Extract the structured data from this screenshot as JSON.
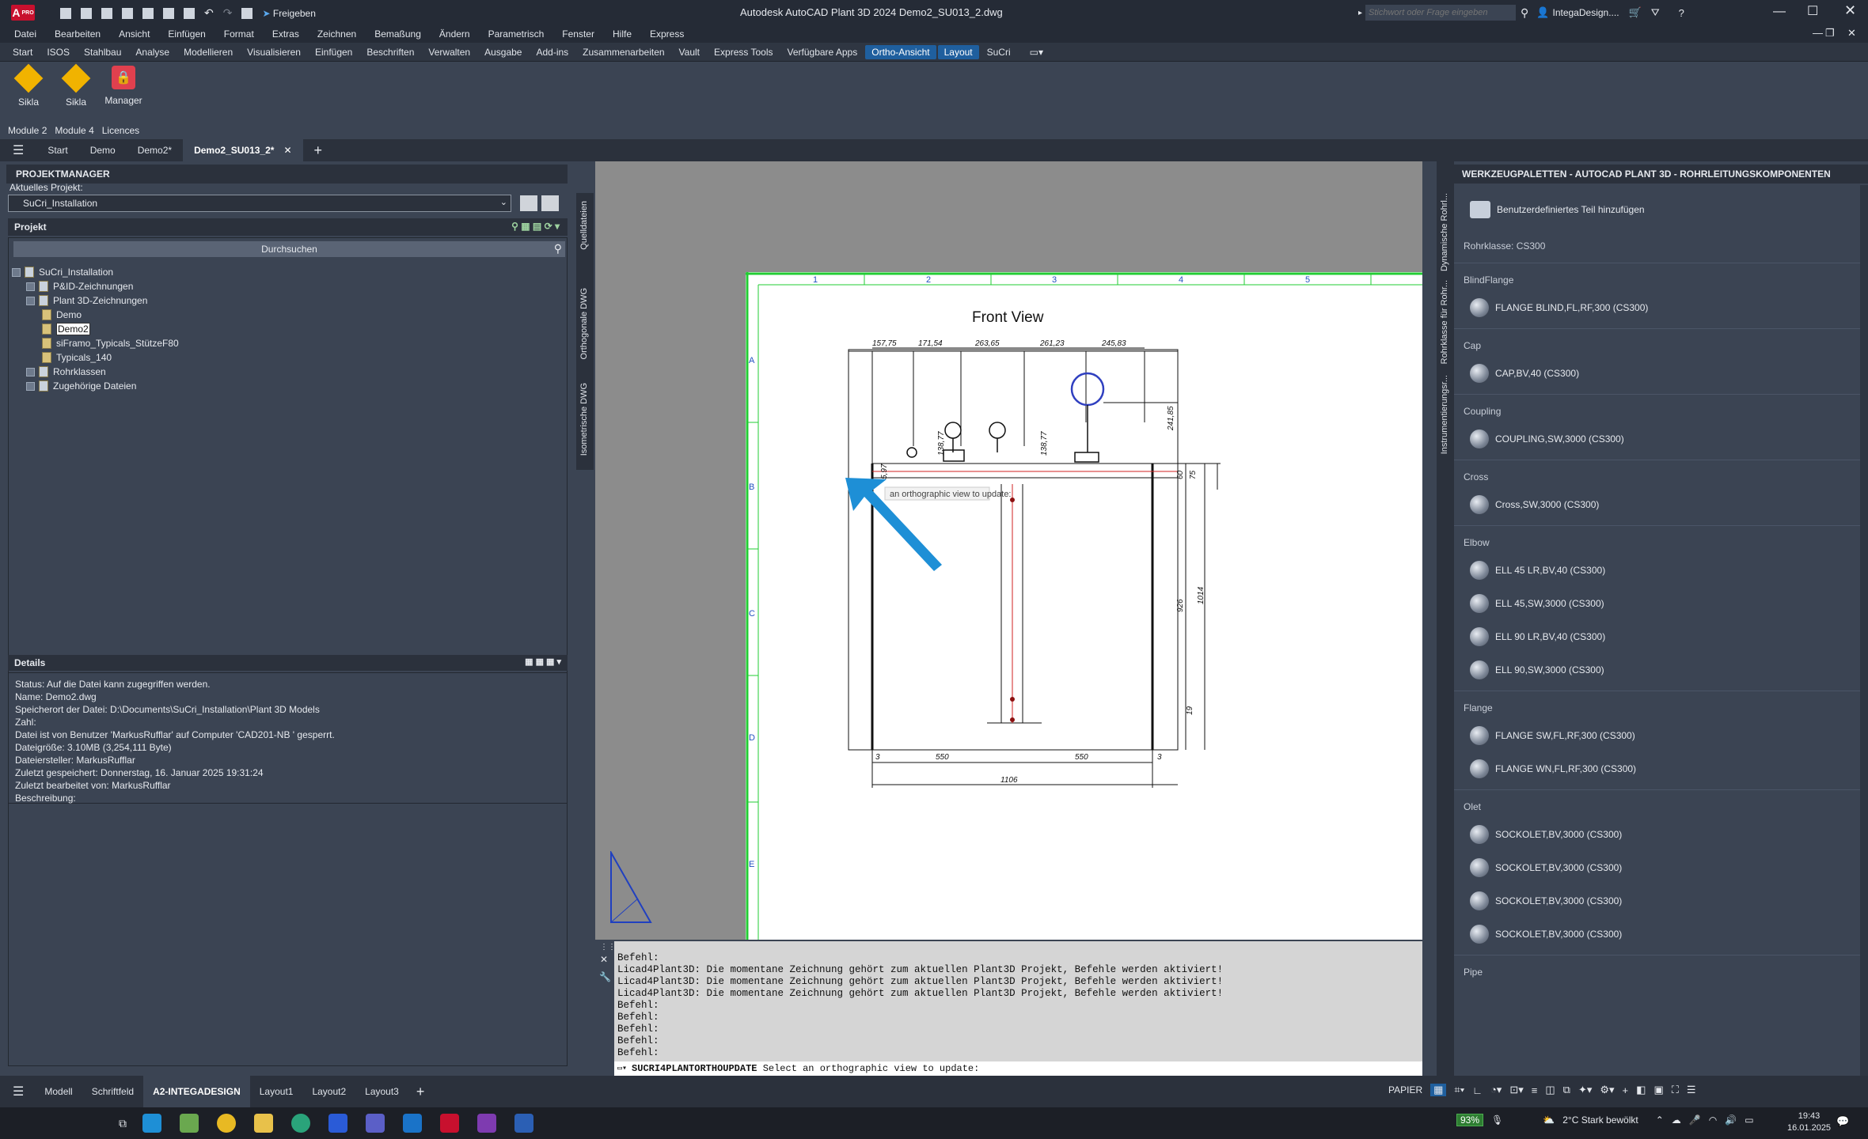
{
  "titlebar": {
    "app_badge": "A",
    "app_sub": "PRO",
    "share": "Freigeben",
    "title": "Autodesk AutoCAD Plant 3D 2024   Demo2_SU013_2.dwg",
    "search_placeholder": "Stichwort oder Frage eingeben",
    "user": "IntegaDesign...."
  },
  "menu": [
    "Datei",
    "Bearbeiten",
    "Ansicht",
    "Einfügen",
    "Format",
    "Extras",
    "Zeichnen",
    "Bemaßung",
    "Ändern",
    "Parametrisch",
    "Fenster",
    "Hilfe",
    "Express"
  ],
  "ribbon_tabs": [
    "Start",
    "ISOS",
    "Stahlbau",
    "Analyse",
    "Modellieren",
    "Visualisieren",
    "Einfügen",
    "Beschriften",
    "Verwalten",
    "Ausgabe",
    "Add-ins",
    "Zusammenarbeiten",
    "Vault",
    "Express Tools",
    "Verfügbare Apps",
    "Ortho-Ansicht",
    "Layout",
    "SuCri"
  ],
  "ribbon_buttons": [
    "Sikla",
    "Sikla",
    "Manager"
  ],
  "modules": [
    "Module 2",
    "Module 4",
    "Licences"
  ],
  "doc_tabs": [
    "Start",
    "Demo",
    "Demo2*",
    "Demo2_SU013_2*"
  ],
  "pm": {
    "title": "PROJEKTMANAGER",
    "current_label": "Aktuelles Projekt:",
    "current_value": "SuCri_Installation",
    "project_label": "Projekt",
    "search_btn": "Durchsuchen",
    "tree": [
      "SuCri_Installation",
      "P&ID-Zeichnungen",
      "Plant 3D-Zeichnungen",
      "Demo",
      "Demo2",
      "siFramo_Typicals_StützeF80",
      "Typicals_140",
      "Rohrklassen",
      "Zugehörige Dateien"
    ],
    "details_label": "Details",
    "details": [
      "Status: Auf die Datei kann zugegriffen werden.",
      "Name:  Demo2.dwg",
      "Speicherort der Datei:  D:\\Documents\\SuCri_Installation\\Plant 3D Models",
      "Zahl:",
      "Datei ist von Benutzer 'MarkusRufflar' auf Computer 'CAD201-NB ' gesperrt.",
      "Dateigröße: 3.10MB (3,254,111 Byte)",
      "Dateiersteller:  MarkusRufflar",
      "Zuletzt gespeichert: Donnerstag, 16. Januar 2025 19:31:24",
      "Zuletzt bearbeitet von:  MarkusRufflar",
      "Beschreibung:"
    ]
  },
  "vtabs_left": [
    "Quelldateien",
    "Orthogonale DWG",
    "Isometrische DWG"
  ],
  "drawing": {
    "view_title": "Front View",
    "col_labels": [
      "1",
      "2",
      "3",
      "4",
      "5"
    ],
    "row_labels": [
      "A",
      "B",
      "C",
      "D",
      "E"
    ],
    "dims_top": [
      "157,75",
      "171,54",
      "263,65",
      "261,23",
      "245,83"
    ],
    "dims_bottom": [
      "3",
      "550",
      "550",
      "3",
      "1106"
    ],
    "dims_right": [
      "241,85",
      "60",
      "75",
      "926",
      "1014",
      "19"
    ],
    "dims_mid": [
      "138,77",
      "138,77",
      "5,97"
    ],
    "tooltip": "an orthographic view to update:"
  },
  "cmd": {
    "lines": [
      "Befehl:",
      "Licad4Plant3D: Die momentane Zeichnung gehört zum aktuellen Plant3D Projekt, Befehle werden aktiviert!",
      "Licad4Plant3D: Die momentane Zeichnung gehört zum aktuellen Plant3D Projekt, Befehle werden aktiviert!",
      "Licad4Plant3D: Die momentane Zeichnung gehört zum aktuellen Plant3D Projekt, Befehle werden aktiviert!",
      "Befehl:",
      "Befehl:",
      "Befehl:",
      "Befehl:",
      "Befehl:"
    ],
    "input_cmd": "SUCRI4PLANTORTHOUPDATE",
    "input_prompt": "Select an orthographic view to update:"
  },
  "palette": {
    "title": "WERKZEUGPALETTEN - AUTOCAD PLANT 3D - ROHRLEITUNGSKOMPONENTEN",
    "custom": "Benutzerdefiniertes Teil hinzufügen",
    "rohrklasse": "Rohrklasse: CS300",
    "vtabs": [
      "Dynamische Rohrl...",
      "Rohrklasse für Rohr...",
      "Instrumentierungsr..."
    ],
    "groups": [
      {
        "name": "BlindFlange",
        "items": [
          "FLANGE BLIND,FL,RF,300 (CS300)"
        ]
      },
      {
        "name": "Cap",
        "items": [
          "CAP,BV,40 (CS300)"
        ]
      },
      {
        "name": "Coupling",
        "items": [
          "COUPLING,SW,3000 (CS300)"
        ]
      },
      {
        "name": "Cross",
        "items": [
          "Cross,SW,3000 (CS300)"
        ]
      },
      {
        "name": "Elbow",
        "items": [
          "ELL 45 LR,BV,40 (CS300)",
          "ELL 45,SW,3000 (CS300)",
          "ELL 90 LR,BV,40 (CS300)",
          "ELL 90,SW,3000 (CS300)"
        ]
      },
      {
        "name": "Flange",
        "items": [
          "FLANGE SW,FL,RF,300 (CS300)",
          "FLANGE WN,FL,RF,300 (CS300)"
        ]
      },
      {
        "name": "Olet",
        "items": [
          "SOCKOLET,BV,3000 (CS300)",
          "SOCKOLET,BV,3000 (CS300)",
          "SOCKOLET,BV,3000 (CS300)",
          "SOCKOLET,BV,3000 (CS300)"
        ]
      },
      {
        "name": "Pipe",
        "items": []
      }
    ]
  },
  "layout_tabs": [
    "Modell",
    "Schriftfeld",
    "A2-INTEGADESIGN",
    "Layout1",
    "Layout2",
    "Layout3"
  ],
  "status": {
    "paper": "PAPIER"
  },
  "taskbar": {
    "battery": "93%",
    "weather": "2°C  Stark bewölkt",
    "time": "19:43",
    "date": "16.01.2025"
  },
  "colors": {
    "accent": "#1f5f9e",
    "grid_green": "#22cc33",
    "annotation": "#1e8fd6"
  }
}
